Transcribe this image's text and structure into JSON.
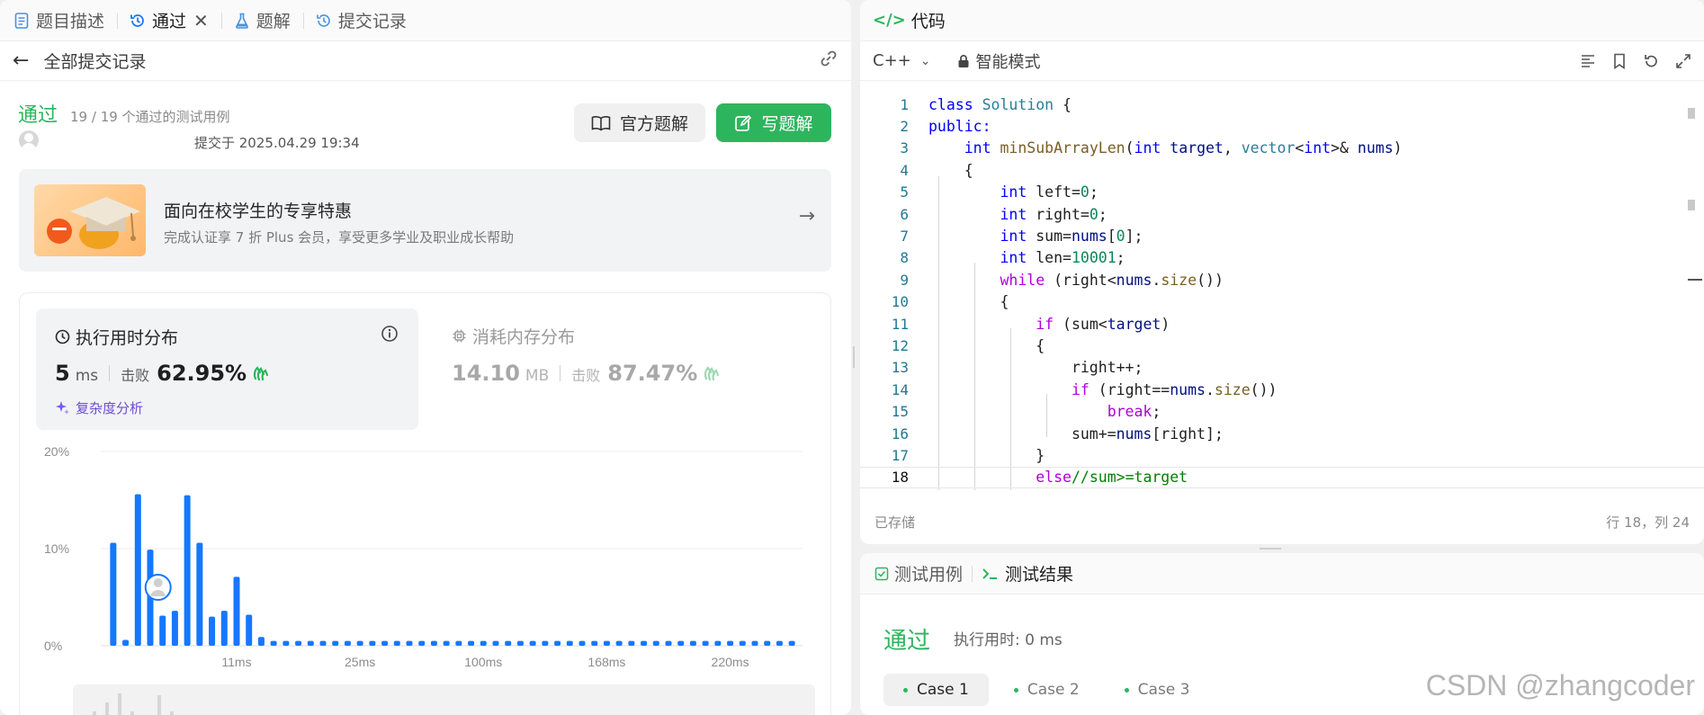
{
  "tabs": [
    {
      "label": "题目描述"
    },
    {
      "label": "通过"
    },
    {
      "label": "题解"
    },
    {
      "label": "提交记录"
    }
  ],
  "subbar": {
    "back_label": "全部提交记录"
  },
  "submission": {
    "status": "通过",
    "cases": "19 / 19 个通过的测试用例",
    "submitted_at": "提交于 2025.04.29 19:34"
  },
  "buttons": {
    "official": "官方题解",
    "write": "写题解"
  },
  "promo": {
    "title": "面向在校学生的专享特惠",
    "subtitle": "完成认证享 7 折 Plus 会员，享受更多学业及职业成长帮助"
  },
  "runtime": {
    "title": "执行用时分布",
    "value": "5",
    "unit": "ms",
    "beat_label": "击败",
    "beat_pct": "62.95%",
    "complexity": "复杂度分析"
  },
  "memory": {
    "title": "消耗内存分布",
    "value": "14.10",
    "unit": "MB",
    "beat_label": "击败",
    "beat_pct": "87.47%"
  },
  "chart_data": {
    "type": "bar",
    "ylim": [
      0,
      20
    ],
    "yticks": [
      "20%",
      "10%",
      "0%"
    ],
    "xtick_labels": [
      "11ms",
      "25ms",
      "100ms",
      "168ms",
      "220ms"
    ],
    "values": [
      10.6,
      0.6,
      15.6,
      9.9,
      3.1,
      3.6,
      15.5,
      10.6,
      3.0,
      3.6,
      7.1,
      3.2,
      0.9,
      0.5,
      0.5,
      0.5,
      0.5,
      0.5,
      0.5,
      0.5,
      0.5,
      0.5,
      0.5,
      0.5,
      0.5,
      0.5,
      0.5,
      0.5,
      0.5,
      0.5,
      0.5,
      0.5,
      0.5,
      0.5,
      0.5,
      0.5,
      0.5,
      0.5,
      0.5,
      0.5,
      0.5,
      0.5,
      0.5,
      0.5,
      0.5,
      0.5,
      0.5,
      0.5,
      0.5,
      0.5,
      0.5,
      0.5,
      0.5,
      0.5,
      0.5,
      0.5
    ],
    "bar_color": "#1677ff",
    "grid": true
  },
  "code": {
    "header": "代码",
    "language": "C++",
    "mode": "智能模式",
    "lines": [
      "class Solution {",
      "public:",
      "    int minSubArrayLen(int target, vector<int>& nums)",
      "    {",
      "        int left=0;",
      "        int right=0;",
      "        int sum=nums[0];",
      "        int len=10001;",
      "        while (right<nums.size())",
      "        {",
      "            if (sum<target)",
      "            {",
      "                right++;",
      "                if (right==nums.size())",
      "                    break;",
      "                sum+=nums[right];",
      "            }",
      "            else//sum>=target"
    ],
    "saved": "已存储",
    "cursor": "行 18，列 24"
  },
  "result": {
    "tab_cases": "测试用例",
    "tab_result": "测试结果",
    "status": "通过",
    "time": "执行用时: 0 ms",
    "cases": [
      "Case 1",
      "Case 2",
      "Case 3"
    ]
  },
  "watermark": "CSDN @zhangcoder",
  "colors": {
    "accent_green": "#2db55d",
    "bar_blue": "#1677ff",
    "purple": "#6d4ed6"
  }
}
